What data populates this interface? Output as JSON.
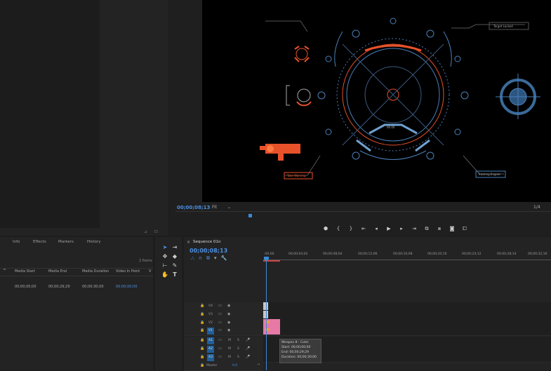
{
  "program": {
    "timecode": "00;00;08;13",
    "fit": "Fit",
    "resolution": "1/4",
    "hud": {
      "top_right_label": "Target Locked",
      "bottom_left_label": "Take Warning",
      "bottom_right_label": "Tracking Engine",
      "center_readout": "00.00"
    }
  },
  "source": {
    "footer_icons": "⊿ ⊡"
  },
  "project": {
    "tabs": [
      "Info",
      "Effects",
      "Markers",
      "History"
    ],
    "items_count": "2 Items",
    "columns": [
      "Media Start",
      "Media End",
      "Media Duration",
      "Video In Point",
      "V"
    ],
    "row": {
      "media_start": "00;00;00;00",
      "media_end": "00;00;29;29",
      "media_duration": "00;00;30;00",
      "video_in_point": "00;00;00;00"
    }
  },
  "sequence": {
    "tab": "Sequence 01",
    "timecode": "00;00;08;13",
    "ruler": [
      ":00;00",
      "00;00;04;02",
      "00;00;08;04",
      "00;00;12;06",
      "00;00;16;08",
      "00;00;20;10",
      "00;00;24;12",
      "00;00;28;14",
      "00;00;32;16"
    ],
    "video_tracks": [
      "V4",
      "V3",
      "V2",
      "V1"
    ],
    "audio_tracks": [
      "A1",
      "A2",
      "A3"
    ],
    "master": {
      "label": "Master",
      "value": "0.0"
    },
    "tooltip": {
      "name": "Weapon 8 - Color",
      "start": "Start: 00;00;00;00",
      "end": "End: 00;00;29;29",
      "duration": "Duration: 00;00;30;00"
    }
  },
  "colors": {
    "accent": "#3a8ad8",
    "hud_blue": "#4a7fb8",
    "hud_orange": "#e8522a",
    "clip_pink": "#e779a7"
  }
}
